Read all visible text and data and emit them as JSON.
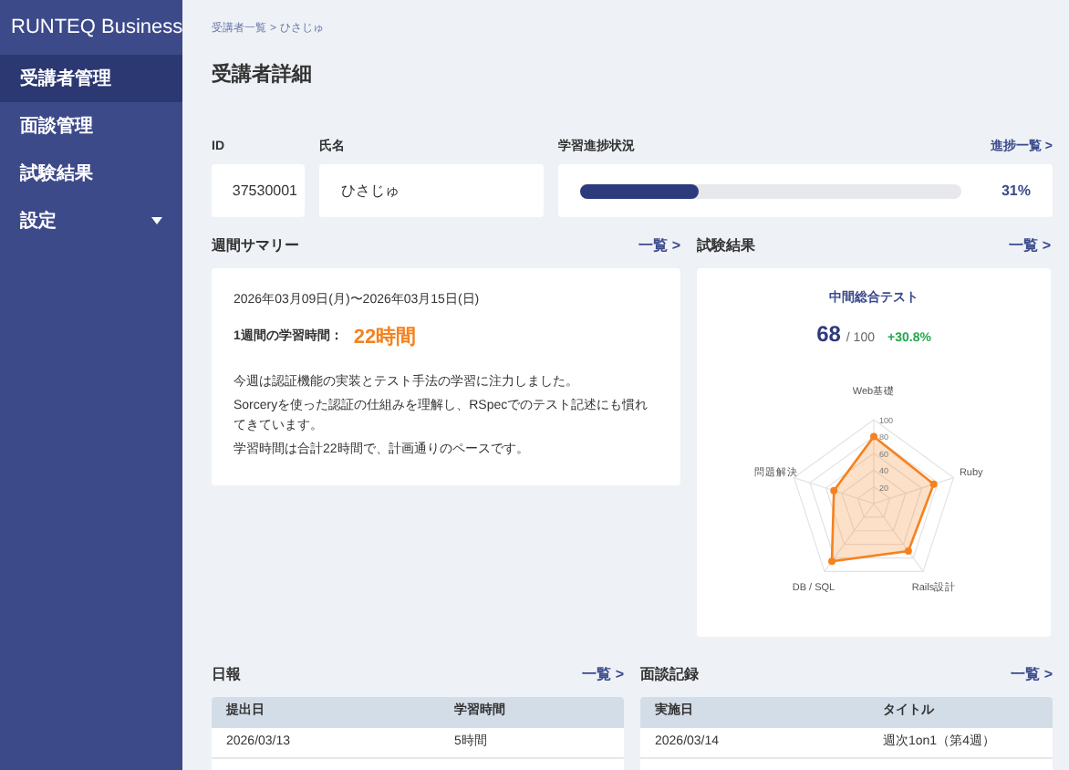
{
  "sidebar": {
    "brand": "RUNTEQ Business",
    "items": [
      {
        "label": "受講者管理",
        "selected": true
      },
      {
        "label": "面談管理",
        "selected": false
      },
      {
        "label": "試験結果",
        "selected": false
      },
      {
        "label": "設定",
        "selected": false,
        "has_caret": true
      }
    ]
  },
  "breadcrumb": {
    "items": [
      "受講者一覧",
      "ひさじゅ"
    ],
    "separator": ">"
  },
  "page_title": "受講者詳細",
  "profile": {
    "id_label": "ID",
    "id_value": "37530001",
    "name_label": "氏名",
    "name_value": "ひさじゅ"
  },
  "progress": {
    "label": "学習進捗状況",
    "link": "進捗一覧 >",
    "level": 0.31,
    "reading": "31%"
  },
  "weekly_summary": {
    "label": "週間サマリー",
    "link": "一覧 >",
    "period": "2026年03月09日(月)〜2026年03月15日(日)",
    "hours_label": "1週間の学習時間：",
    "hours_value": "22時間",
    "lines": [
      "今週は認証機能の実装とテスト手法の学習に注力しました。",
      "Sorceryを使った認証の仕組みを理解し、RSpecでのテスト記述にも慣れてきています。",
      "学習時間は合計22時間で、計画通りのペースです。"
    ]
  },
  "test_results": {
    "label": "試験結果",
    "link": "一覧 >",
    "test_name": "中間総合テスト",
    "score": "68",
    "total": "/ 100",
    "change": "+30.8%",
    "chart_data": {
      "type": "radar",
      "categories": [
        "Web基礎",
        "Ruby",
        "Rails設計",
        "DB / SQL",
        "問題解決"
      ],
      "series": [
        {
          "color": "#f5821f",
          "values": [
            80,
            75,
            70,
            85,
            50
          ]
        }
      ],
      "ylim": [
        0,
        100
      ],
      "yticks": [
        20,
        40,
        60,
        80,
        100
      ]
    }
  },
  "daily_reports": {
    "label": "日報",
    "link": "一覧 >",
    "columns": [
      "提出日",
      "学習時間"
    ],
    "rows": [
      [
        "2026/03/13",
        "5時間"
      ]
    ]
  },
  "interviews": {
    "label": "面談記録",
    "link": "一覧 >",
    "columns": [
      "実施日",
      "タイトル"
    ],
    "rows": [
      [
        "2026/03/14",
        "週次1on1（第4週）"
      ]
    ]
  }
}
